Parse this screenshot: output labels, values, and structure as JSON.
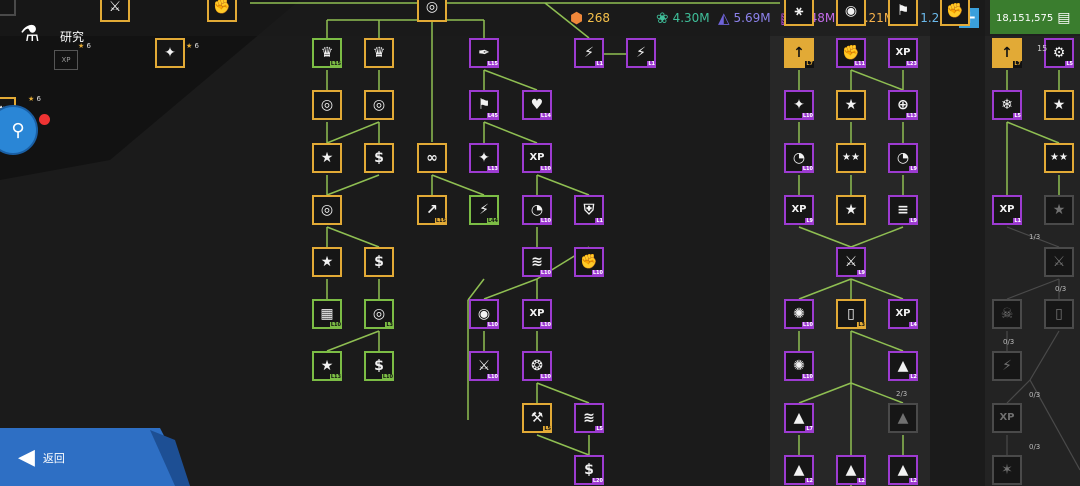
{
  "title": "研究",
  "back_label": "返回",
  "xp_label": "XP",
  "star_counts": [
    "6",
    "6",
    "6"
  ],
  "resources": [
    {
      "name": "tokens",
      "value": "268",
      "color": "#f0883a",
      "icon": "hex-coin-icon"
    },
    {
      "name": "biomass",
      "value": "4.30M",
      "color": "#3fbf9a",
      "icon": "leaf-icon"
    },
    {
      "name": "metal",
      "value": "5.69M",
      "color": "#6e63d8",
      "icon": "triangle-icon"
    },
    {
      "name": "crystal",
      "value": "1.48M",
      "color": "#b14ad6",
      "icon": "stripes-icon"
    },
    {
      "name": "energy",
      "value": "1.21M",
      "color": "#f0a23a",
      "icon": "orb-icon"
    },
    {
      "name": "ice",
      "value": "1.21M",
      "color": "#4aa3d8",
      "icon": "shard-icon"
    }
  ],
  "currency": {
    "value": "18,151,575",
    "icon": "cash-icon"
  },
  "right_panel_top": "15",
  "fraction_labels": [
    "1/3",
    "0/3",
    "0/3",
    "0/3",
    "2/3",
    "0/3"
  ],
  "nodes": [
    {
      "id": "n1",
      "glyph": "♛",
      "level": "L15",
      "color": "green"
    },
    {
      "id": "n2",
      "glyph": "♛",
      "level": "",
      "color": "gold"
    },
    {
      "id": "n3",
      "glyph": "◎",
      "level": "",
      "color": "gold"
    },
    {
      "id": "n4",
      "glyph": "◎",
      "level": "",
      "color": "gold"
    },
    {
      "id": "n5",
      "glyph": "★",
      "level": "",
      "color": "gold"
    },
    {
      "id": "n6",
      "glyph": "$",
      "level": "",
      "color": "gold"
    },
    {
      "id": "n7",
      "glyph": "◎",
      "level": "",
      "color": "gold"
    },
    {
      "id": "n8",
      "glyph": "★",
      "level": "",
      "color": "gold"
    },
    {
      "id": "n9",
      "glyph": "$",
      "level": "",
      "color": "gold"
    },
    {
      "id": "n10",
      "glyph": "▦",
      "level": "L10",
      "color": "green"
    },
    {
      "id": "n11",
      "glyph": "◎",
      "level": "L3",
      "color": "green"
    },
    {
      "id": "n12",
      "glyph": "★",
      "level": "L13",
      "color": "green"
    },
    {
      "id": "n13",
      "glyph": "$",
      "level": "L10",
      "color": "green"
    },
    {
      "id": "n14",
      "glyph": "∞",
      "level": "",
      "color": "gold"
    },
    {
      "id": "n15",
      "glyph": "↗",
      "level": "L15",
      "color": "gold"
    },
    {
      "id": "n16",
      "glyph": "⚡",
      "level": "L44",
      "color": "green"
    },
    {
      "id": "n17",
      "glyph": "✒",
      "level": "L15",
      "color": "purple"
    },
    {
      "id": "n18",
      "glyph": "⚡",
      "level": "L1",
      "color": "purple"
    },
    {
      "id": "n19",
      "glyph": "⚡",
      "level": "L1",
      "color": "purple"
    },
    {
      "id": "n20",
      "glyph": "⚑",
      "level": "L45",
      "color": "purple"
    },
    {
      "id": "n21",
      "glyph": "♥",
      "level": "L14",
      "color": "purple"
    },
    {
      "id": "n22",
      "glyph": "✦",
      "level": "L13",
      "color": "purple"
    },
    {
      "id": "n23",
      "glyph": "XP",
      "level": "L10",
      "color": "purple"
    },
    {
      "id": "n24",
      "glyph": "◔",
      "level": "L10",
      "color": "purple"
    },
    {
      "id": "n25",
      "glyph": "⛨",
      "level": "L1",
      "color": "purple"
    },
    {
      "id": "n26",
      "glyph": "≋",
      "level": "L10",
      "color": "purple"
    },
    {
      "id": "n27",
      "glyph": "✊",
      "level": "L10",
      "color": "purple"
    },
    {
      "id": "n28",
      "glyph": "◉",
      "level": "L10",
      "color": "purple"
    },
    {
      "id": "n29",
      "glyph": "XP",
      "level": "L10",
      "color": "purple"
    },
    {
      "id": "n30",
      "glyph": "⚔",
      "level": "L10",
      "color": "purple"
    },
    {
      "id": "n31",
      "glyph": "❂",
      "level": "L10",
      "color": "purple"
    },
    {
      "id": "n32",
      "glyph": "⚒",
      "level": "L5",
      "color": "gold"
    },
    {
      "id": "n33",
      "glyph": "≋",
      "level": "L5",
      "color": "purple"
    },
    {
      "id": "n34",
      "glyph": "$",
      "level": "L20",
      "color": "purple"
    },
    {
      "id": "n35",
      "glyph": "↑",
      "level": "L7",
      "color": "fill-gold"
    },
    {
      "id": "n36",
      "glyph": "✊",
      "level": "L11",
      "color": "purple"
    },
    {
      "id": "n37",
      "glyph": "XP",
      "level": "L23",
      "color": "purple"
    },
    {
      "id": "n38",
      "glyph": "✦",
      "level": "L10",
      "color": "purple"
    },
    {
      "id": "n39",
      "glyph": "★",
      "level": "",
      "color": "gold"
    },
    {
      "id": "n40",
      "glyph": "⊕",
      "level": "L13",
      "color": "purple"
    },
    {
      "id": "n41",
      "glyph": "◔",
      "level": "L10",
      "color": "purple"
    },
    {
      "id": "n42",
      "glyph": "★★",
      "level": "",
      "color": "gold"
    },
    {
      "id": "n43",
      "glyph": "◔",
      "level": "L9",
      "color": "purple"
    },
    {
      "id": "n44",
      "glyph": "XP",
      "level": "L9",
      "color": "purple"
    },
    {
      "id": "n45",
      "glyph": "★",
      "level": "",
      "color": "gold"
    },
    {
      "id": "n46",
      "glyph": "≡",
      "level": "L9",
      "color": "purple"
    },
    {
      "id": "n47",
      "glyph": "⚔",
      "level": "L9",
      "color": "purple"
    },
    {
      "id": "n48",
      "glyph": "✺",
      "level": "L10",
      "color": "purple"
    },
    {
      "id": "n49",
      "glyph": "▯",
      "level": "L3",
      "color": "gold"
    },
    {
      "id": "n50",
      "glyph": "XP",
      "level": "L4",
      "color": "purple"
    },
    {
      "id": "n51",
      "glyph": "✺",
      "level": "L10",
      "color": "purple"
    },
    {
      "id": "n52",
      "glyph": "▲",
      "level": "L2",
      "color": "purple"
    },
    {
      "id": "n53",
      "glyph": "▲",
      "level": "L7",
      "color": "purple"
    },
    {
      "id": "n54",
      "glyph": "▲",
      "level": "",
      "color": "gray"
    },
    {
      "id": "n55",
      "glyph": "▲",
      "level": "L2",
      "color": "purple"
    },
    {
      "id": "n56",
      "glyph": "▲",
      "level": "L2",
      "color": "purple"
    },
    {
      "id": "n57",
      "glyph": "▲",
      "level": "L2",
      "color": "purple"
    },
    {
      "id": "n58",
      "glyph": "↑",
      "level": "L7",
      "color": "fill-gold"
    },
    {
      "id": "n59",
      "glyph": "⚙",
      "level": "L5",
      "color": "purple"
    },
    {
      "id": "n60",
      "glyph": "❄",
      "level": "L5",
      "color": "purple"
    },
    {
      "id": "n61",
      "glyph": "★",
      "level": "",
      "color": "gold"
    },
    {
      "id": "n62",
      "glyph": "★★",
      "level": "",
      "color": "gold"
    },
    {
      "id": "n63",
      "glyph": "XP",
      "level": "L1",
      "color": "purple"
    },
    {
      "id": "n64",
      "glyph": "★",
      "level": "",
      "color": "gray"
    },
    {
      "id": "n65",
      "glyph": "⚔",
      "level": "",
      "color": "gray"
    },
    {
      "id": "n66",
      "glyph": "☠",
      "level": "",
      "color": "gray"
    },
    {
      "id": "n67",
      "glyph": "▯",
      "level": "",
      "color": "gray"
    },
    {
      "id": "n68",
      "glyph": "⚡",
      "level": "",
      "color": "gray"
    },
    {
      "id": "n69",
      "glyph": "XP",
      "level": "",
      "color": "gray"
    },
    {
      "id": "n70",
      "glyph": "✶",
      "level": "",
      "color": "gray"
    },
    {
      "id": "n71",
      "glyph": "◉",
      "level": "",
      "color": "gold"
    },
    {
      "id": "n72",
      "glyph": "⚑",
      "level": "",
      "color": "gold"
    },
    {
      "id": "n73",
      "glyph": "⚹",
      "level": "",
      "color": "gold"
    },
    {
      "id": "n74",
      "glyph": "✊",
      "level": "",
      "color": "gold"
    }
  ]
}
